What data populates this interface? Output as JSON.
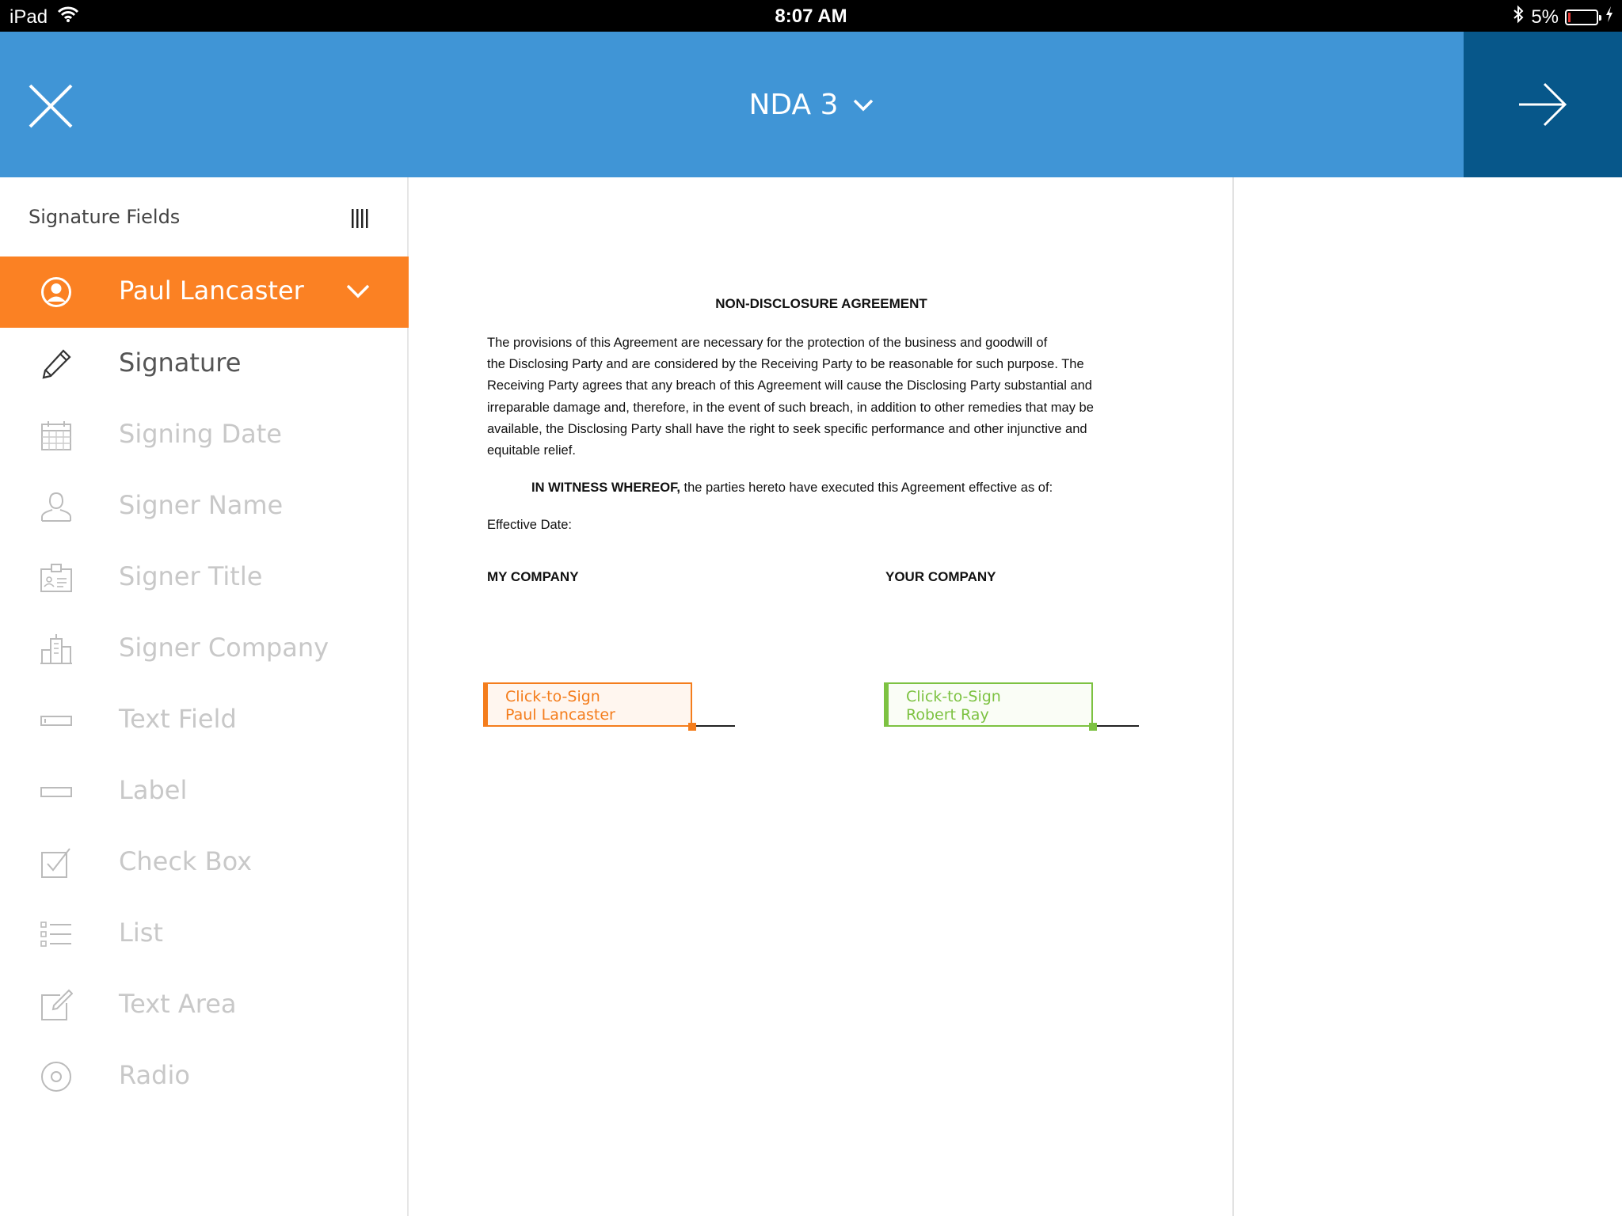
{
  "status_bar": {
    "device": "iPad",
    "time": "8:07 AM",
    "battery": "5%"
  },
  "header": {
    "title": "NDA 3"
  },
  "sidebar": {
    "title": "Signature Fields",
    "signer": "Paul Lancaster",
    "fields": [
      {
        "label": "Signature",
        "icon": "pen-icon",
        "active": true
      },
      {
        "label": "Signing Date",
        "icon": "calendar-icon",
        "active": false
      },
      {
        "label": "Signer Name",
        "icon": "person-icon",
        "active": false
      },
      {
        "label": "Signer Title",
        "icon": "id-card-icon",
        "active": false
      },
      {
        "label": "Signer Company",
        "icon": "building-icon",
        "active": false
      },
      {
        "label": "Text Field",
        "icon": "text-field-icon",
        "active": false
      },
      {
        "label": "Label",
        "icon": "label-icon",
        "active": false
      },
      {
        "label": "Check Box",
        "icon": "checkbox-icon",
        "active": false
      },
      {
        "label": "List",
        "icon": "list-icon",
        "active": false
      },
      {
        "label": "Text Area",
        "icon": "text-area-icon",
        "active": false
      },
      {
        "label": "Radio",
        "icon": "radio-icon",
        "active": false
      }
    ]
  },
  "document": {
    "heading": "NON-DISCLOSURE AGREEMENT",
    "paragraph_lines": [
      "The provisions of this Agreement are necessary for the protection of the business and goodwill of",
      "the Disclosing Party and are considered by the Receiving Party to be reasonable for such purpose. The",
      "Receiving Party agrees that any breach of this Agreement will cause the Disclosing Party substantial and",
      "irreparable damage and, therefore, in the event of such breach, in addition to other remedies that may be",
      "available, the Disclosing Party shall have the right to seek specific performance and other injunctive and",
      "equitable relief."
    ],
    "witness_bold": "IN WITNESS WHEREOF,",
    "witness_rest": " the parties hereto have executed this Agreement effective as of:",
    "effective_date_label": "Effective Date:",
    "company_left": "MY COMPANY",
    "company_right": "YOUR COMPANY",
    "sign_fields": [
      {
        "line1": "Click-to-Sign",
        "line2": "Paul Lancaster",
        "color": "#f47d1c"
      },
      {
        "line1": "Click-to-Sign",
        "line2": "Robert Ray",
        "color": "#7dc242"
      }
    ]
  },
  "colors": {
    "header_blue": "#4095d6",
    "next_button_blue": "#07578a",
    "signer_orange": "#fb8123",
    "inactive_text": "#c8c8c8"
  }
}
